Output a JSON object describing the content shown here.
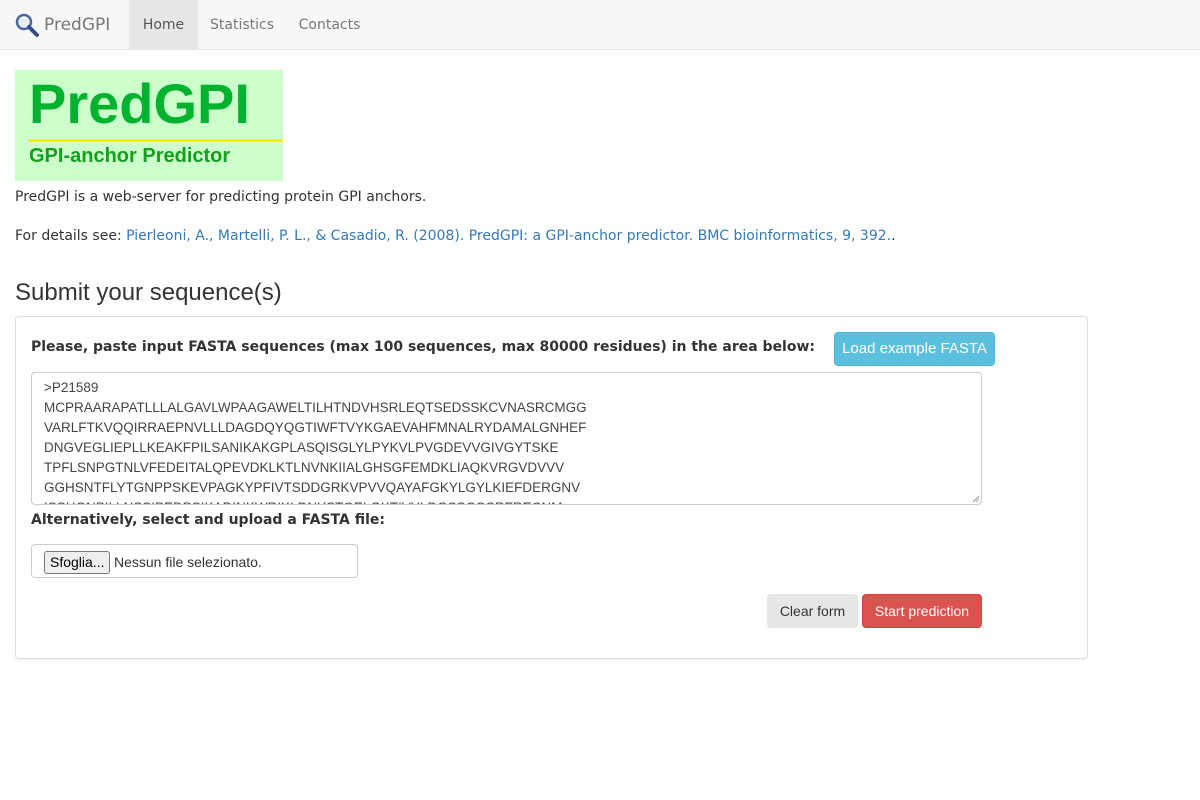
{
  "navbar": {
    "brand_icon": "magnifier-icon",
    "brand": "PredGPI",
    "items": [
      {
        "label": "Home",
        "active": true
      },
      {
        "label": "Statistics",
        "active": false
      },
      {
        "label": "Contacts",
        "active": false
      }
    ]
  },
  "logo": {
    "title": "PredGPI",
    "subtitle": "GPI-anchor Predictor"
  },
  "intro": "PredGPI is a web-server for predicting protein GPI anchors.",
  "details": {
    "prefix": "For details see: ",
    "link": "Pierleoni, A., Martelli, P. L., & Casadio, R. (2008). PredGPI: a GPI-anchor predictor. BMC bioinformatics, 9, 392.",
    "suffix": "."
  },
  "submit": {
    "heading": "Submit your sequence(s)",
    "paste_label": "Please, paste input FASTA sequences (max 100 sequences, max 80000 residues) in the area below:",
    "example_button": "Load example FASTA",
    "fasta_value": ">P21589\nMCPRAARAPATLLLALGAVLWPAAGAWELTILHTNDVHSRLEQTSEDSSKCVNASRCMGG\nVARLFTKVQQIRRAEPNVLLLDAGDQYQGTIWFTVYKGAEVAHFMNALRYDAMALGNHEF\nDNGVEGLIEPLLKEAKFPILSANIKAKGPLASQISGLYLPYKVLPVGDEVVGIVGYTSKE\nTPFLSNPGTNLVFEDEITALQPEVDKLKTLNVNKIIALGHSGFEMDKLIAQKVRGVDVVV\nGGHSNTFLYTGNPPSKEVPAGKYPFIVTSDDGRKVPVVQAYAFGKYLGYLKIEFDERGNV\nISSHGNPILLNSSIPEDPSIKADINKWRIKLDNYSTQELGKTIVYLDGSSQSCRFRECNM",
    "upload_label": "Alternatively, select and upload a FASTA file:",
    "file_button": "Sfoglia...",
    "file_status": "Nessun file selezionato.",
    "clear_button": "Clear form",
    "start_button": "Start prediction"
  },
  "colors": {
    "logo_bg": "#ccffcc",
    "logo_title": "#00b22d",
    "logo_line": "#f5f500",
    "link": "#337ab7",
    "info_button": "#5bc0de",
    "danger_button": "#d9534f"
  }
}
